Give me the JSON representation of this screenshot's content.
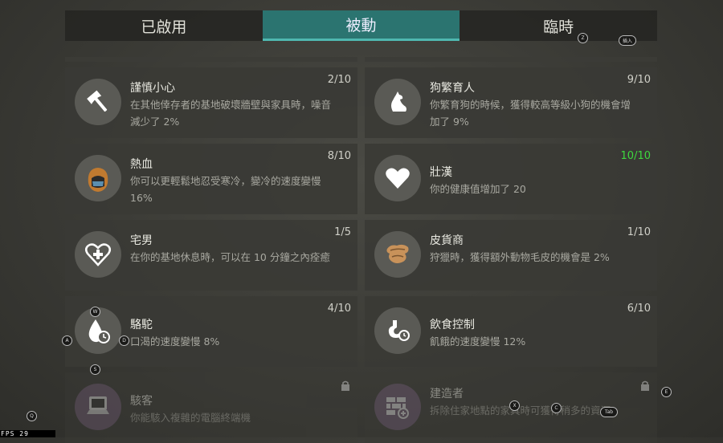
{
  "tabs": [
    {
      "label": "已啟用",
      "active": false
    },
    {
      "label": "被動",
      "active": true
    },
    {
      "label": "臨時",
      "active": false
    }
  ],
  "perks": [
    {
      "name": "謹慎小心",
      "desc": "在其他倖存者的基地破壞牆壁與家具時，噪音減少了 2%",
      "level": "2/10",
      "icon": "axe-icon"
    },
    {
      "name": "狗繁育人",
      "desc": "你繁育狗的時候，獲得較高等級小狗的機會增加了 9%",
      "level": "9/10",
      "icon": "dog-icon"
    },
    {
      "name": "熱血",
      "desc": "你可以更輕鬆地忍受寒冷，變冷的速度變慢 16%",
      "level": "8/10",
      "icon": "warm-hat-icon"
    },
    {
      "name": "壯漢",
      "desc": "你的健康值增加了 20",
      "level": "10/10",
      "icon": "heart-icon",
      "max": true
    },
    {
      "name": "宅男",
      "desc": "在你的基地休息時，可以在 10 分鐘之內痊癒",
      "level": "1/5",
      "icon": "heart-plus-icon"
    },
    {
      "name": "皮貨商",
      "desc": "狩獵時，獲得額外動物毛皮的機會是 2%",
      "level": "1/10",
      "icon": "pelt-icon"
    },
    {
      "name": "駱駝",
      "desc": "口渴的速度變慢 8%",
      "level": "4/10",
      "icon": "water-drop-clock-icon"
    },
    {
      "name": "飲食控制",
      "desc": "飢餓的速度變慢 12%",
      "level": "6/10",
      "icon": "stomach-clock-icon"
    },
    {
      "name": "駭客",
      "desc": "你能駭入複雜的電腦終端機",
      "level": "",
      "icon": "computer-icon",
      "locked": true
    },
    {
      "name": "建造者",
      "desc": "拆除住家地點的家具時可獲得稍多的資源",
      "level": "",
      "icon": "brick-wall-plus-icon",
      "locked": true
    }
  ],
  "keys": {
    "z": "Z",
    "insert": "插入",
    "w": "W",
    "a": "A",
    "d": "D",
    "s": "S",
    "q": "Q",
    "x": "X",
    "c": "C",
    "tab": "Tab",
    "e": "E"
  },
  "fps": "FPS  29",
  "colors": {
    "active_tab": "#2b7470",
    "max_level": "#3ed83e"
  }
}
